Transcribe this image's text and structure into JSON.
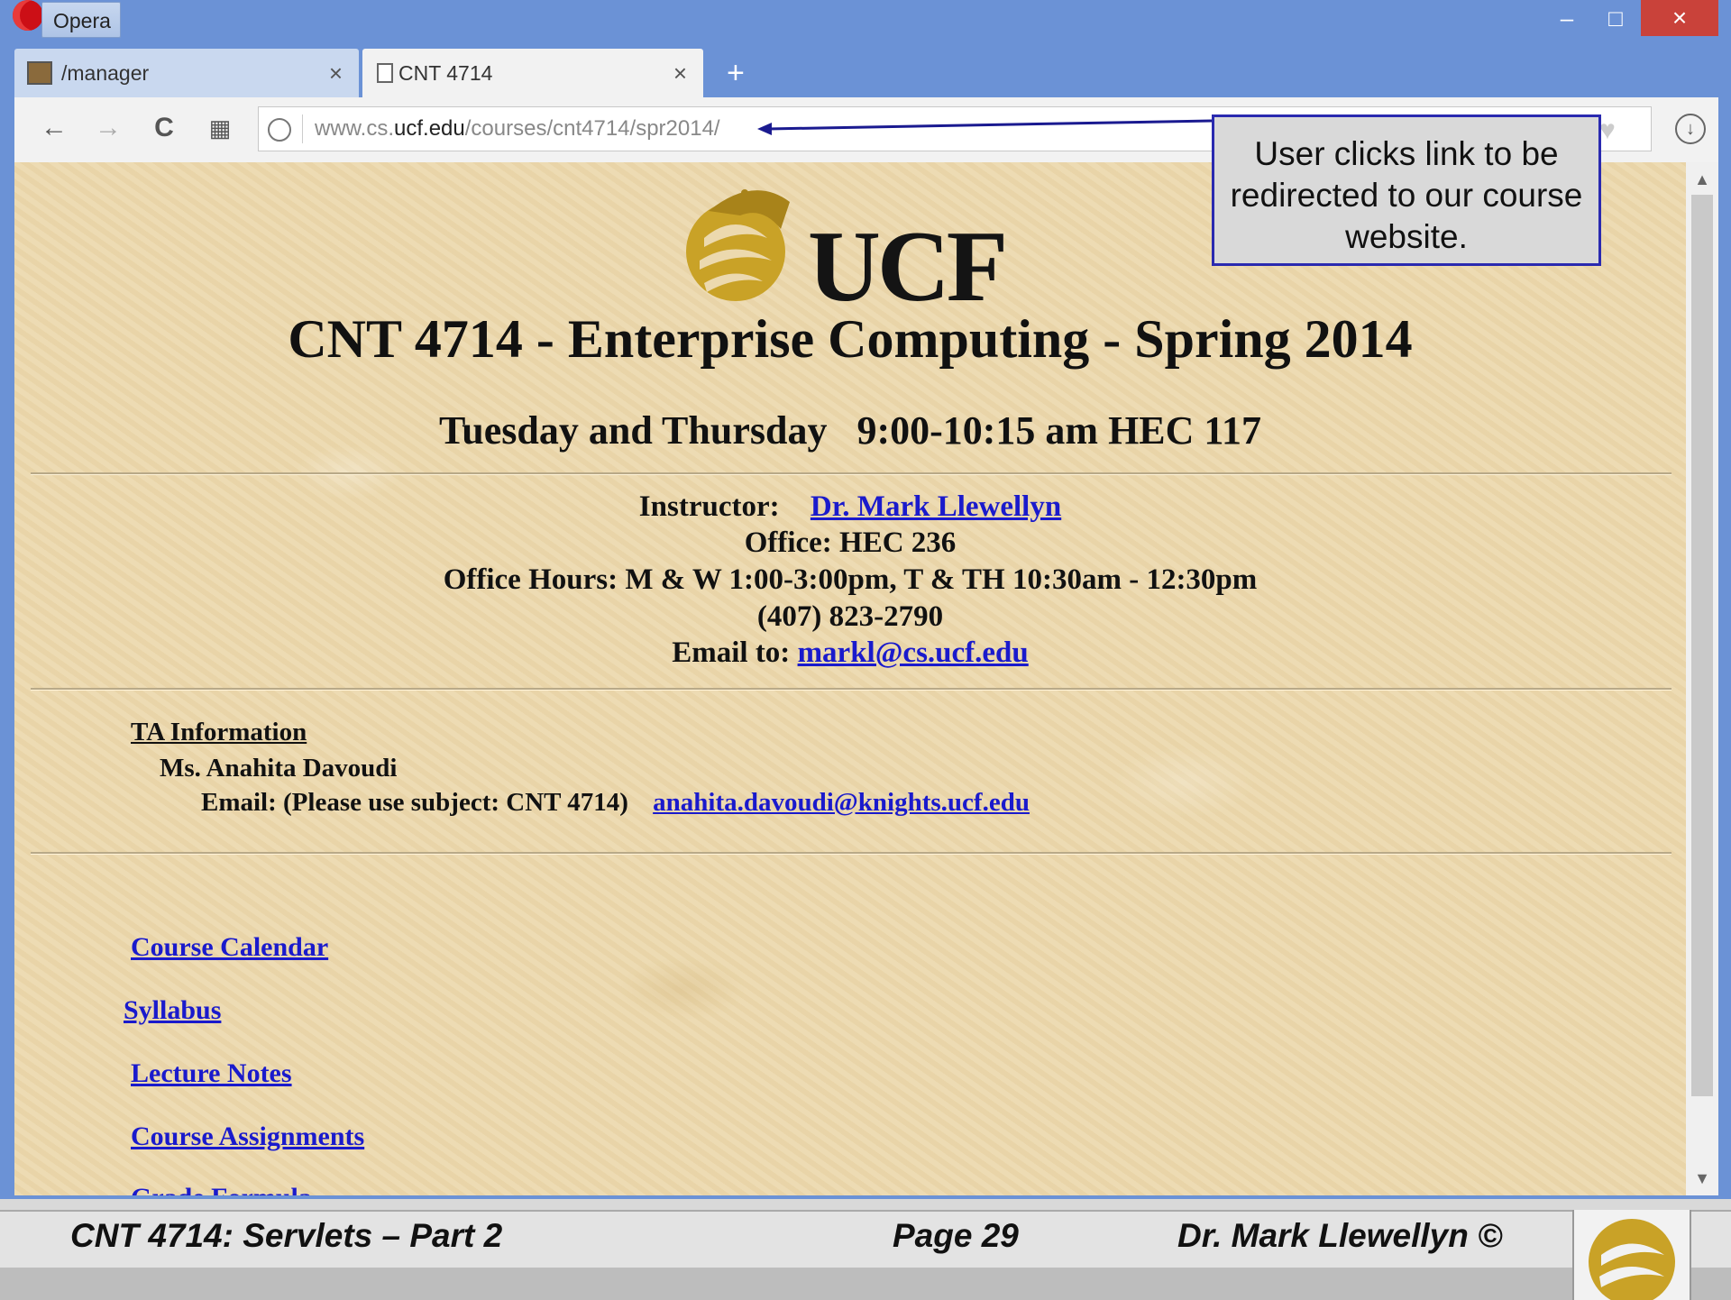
{
  "window": {
    "app_name": "Opera",
    "controls": {
      "minimize": "–",
      "maximize": "□",
      "close": "×"
    }
  },
  "tabs": [
    {
      "label": "/manager",
      "icon": "image-icon",
      "close": "×"
    },
    {
      "label": "CNT 4714",
      "icon": "document-icon",
      "close": "×"
    }
  ],
  "new_tab": "+",
  "toolbar": {
    "back": "←",
    "forward": "→",
    "reload": "C",
    "speed_dial": "▦",
    "url_prefix": "www.cs.",
    "url_domain": "ucf.edu",
    "url_path": "/courses/cnt4714/spr2014/"
  },
  "page": {
    "logo_text": "UCF",
    "title": "CNT 4714 - Enterprise Computing - Spring 2014",
    "schedule": "Tuesday and Thursday   9:00-10:15 am HEC 117",
    "instructor_label": "Instructor:",
    "instructor_name": "Dr. Mark Llewellyn ",
    "office": "Office: HEC 236",
    "office_hours": "Office Hours: M & W 1:00-3:00pm, T & TH 10:30am - 12:30pm",
    "phone": "(407) 823-2790",
    "email_label": "Email to:",
    "email": "markl@cs.ucf.edu",
    "ta_heading": "TA Information",
    "ta_name": "Ms. Anahita Davoudi",
    "ta_email_label": "Email: (Please use subject: CNT 4714)",
    "ta_email": "anahita.davoudi@knights.ucf.edu",
    "links": [
      "Course Calendar",
      "Syllabus",
      "Lecture Notes",
      "Course Assignments",
      "Grade Formula"
    ]
  },
  "callout": {
    "text": "User clicks link to be redirected to our course website."
  },
  "footer": {
    "course": "CNT 4714: Servlets – Part 2",
    "page": "Page 29",
    "author": "Dr. Mark Llewellyn ©"
  },
  "colors": {
    "window_frame": "#6b92d6",
    "link": "#1a1acc",
    "callout_border": "#2a2ab0",
    "ucf_gold": "#c9a227"
  }
}
